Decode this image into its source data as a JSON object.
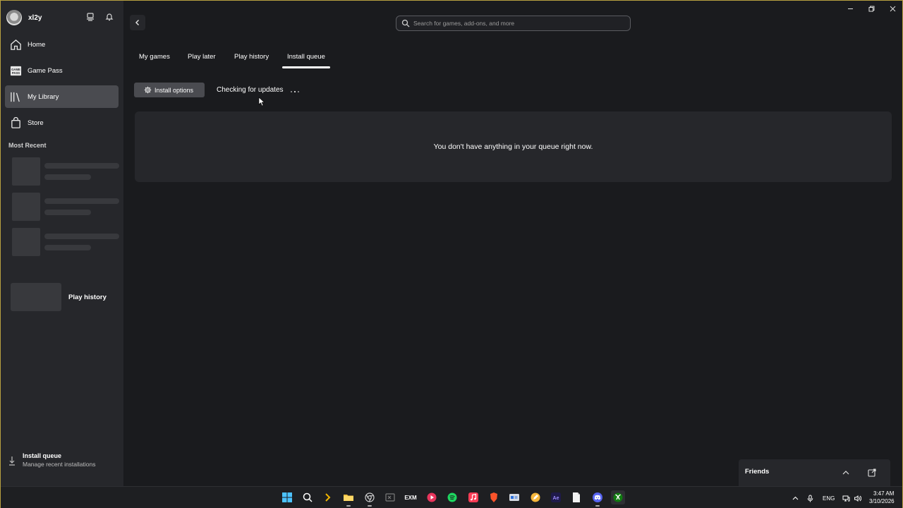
{
  "profile": {
    "username": "xl2y"
  },
  "sidebar": {
    "items": [
      {
        "label": "Home",
        "icon": "home-icon"
      },
      {
        "label": "Game Pass",
        "icon": "game-pass-icon"
      },
      {
        "label": "My Library",
        "icon": "library-icon"
      },
      {
        "label": "Store",
        "icon": "store-icon"
      }
    ],
    "most_recent_title": "Most Recent",
    "play_history_label": "Play history",
    "install_queue": {
      "title": "Install queue",
      "subtitle": "Manage recent installations"
    }
  },
  "search": {
    "placeholder": "Search for games, add-ons, and more"
  },
  "tabs": [
    {
      "label": "My games"
    },
    {
      "label": "Play later"
    },
    {
      "label": "Play history"
    },
    {
      "label": "Install queue"
    }
  ],
  "toolbar": {
    "install_options_label": "Install options",
    "status_text": "Checking for updates"
  },
  "queue": {
    "empty_message": "You don't have anything in your queue right now."
  },
  "friends": {
    "label": "Friends"
  },
  "taskbar": {
    "language": "ENG",
    "time": "3:47 AM",
    "date": "3/10/2026",
    "apps": [
      "windows-start",
      "search",
      "terminal",
      "file-explorer",
      "chrome",
      "excel",
      "exm",
      "media-player",
      "spotify",
      "apple-music",
      "brave",
      "app-window",
      "pen-app",
      "after-effects",
      "notepad",
      "discord",
      "xbox"
    ]
  },
  "colors": {
    "accent_active": "#4a4b50",
    "background": "#1a1b1e",
    "sidebar": "#26272b"
  }
}
